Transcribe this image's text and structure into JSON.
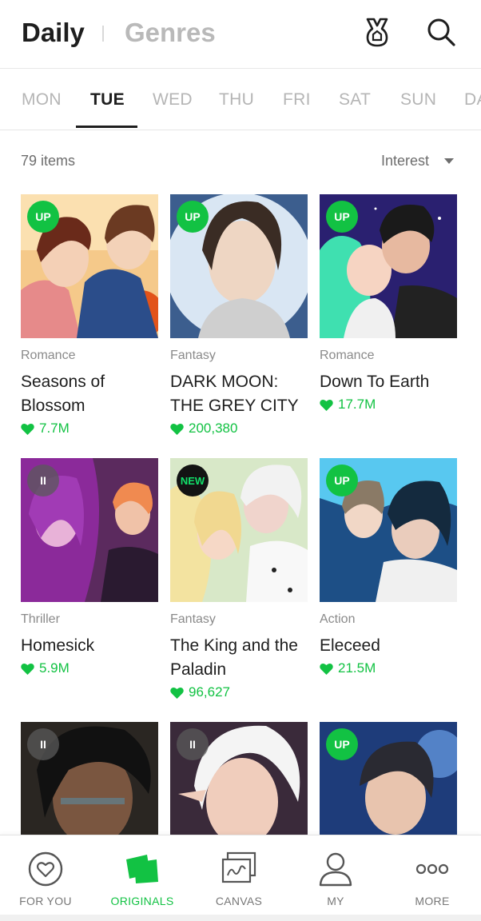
{
  "header": {
    "daily": "Daily",
    "genres": "Genres",
    "icons": [
      "award-icon",
      "search-icon"
    ]
  },
  "tabs": [
    "MON",
    "TUE",
    "WED",
    "THU",
    "FRI",
    "SAT",
    "SUN",
    "DA"
  ],
  "active_tab": "TUE",
  "list": {
    "count": "79 items",
    "sort": "Interest"
  },
  "colors": {
    "accent": "#12c243",
    "text": "#1e1e1e",
    "muted": "#b5b5b5"
  },
  "cards": [
    {
      "badge": "UP",
      "genre": "Romance",
      "title": "Seasons of Blossom",
      "likes": "7.7M"
    },
    {
      "badge": "UP",
      "genre": "Fantasy",
      "title": "DARK MOON: THE GREY CITY",
      "likes": "200,380"
    },
    {
      "badge": "UP",
      "genre": "Romance",
      "title": "Down To Earth",
      "likes": "17.7M"
    },
    {
      "badge": "II",
      "genre": "Thriller",
      "title": "Homesick",
      "likes": "5.9M"
    },
    {
      "badge": "NEW",
      "genre": "Fantasy",
      "title": "The King and the Paladin",
      "likes": "96,627"
    },
    {
      "badge": "UP",
      "genre": "Action",
      "title": "Eleceed",
      "likes": "21.5M"
    },
    {
      "badge": "II"
    },
    {
      "badge": "II"
    },
    {
      "badge": "UP"
    }
  ],
  "nav": [
    {
      "label": "FOR YOU",
      "icon": "heart-circle-icon"
    },
    {
      "label": "ORIGINALS",
      "icon": "originals-icon",
      "active": true
    },
    {
      "label": "CANVAS",
      "icon": "canvas-icon"
    },
    {
      "label": "MY",
      "icon": "user-icon"
    },
    {
      "label": "MORE",
      "icon": "more-icon"
    }
  ]
}
